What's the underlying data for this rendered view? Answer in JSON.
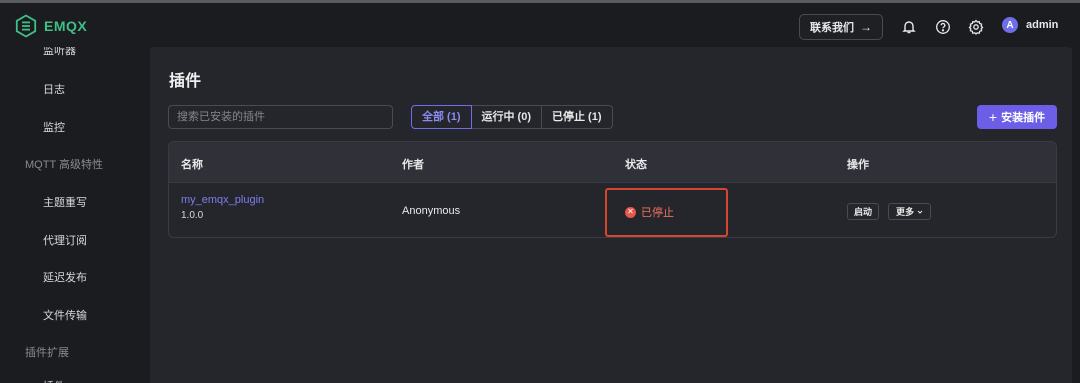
{
  "app": {
    "brand": "EMQX",
    "brand_color": "#3fbf86",
    "accent": "#6d5ee8"
  },
  "header": {
    "contact_label": "联系我们",
    "contact_arrow": "→",
    "icons": [
      "bell-icon",
      "help-icon",
      "settings-icon"
    ],
    "user": {
      "avatar_letter": "A",
      "name": "admin"
    }
  },
  "sidebar": {
    "cut_top_label": "监听器",
    "items": [
      {
        "label": "日志"
      },
      {
        "label": "监控"
      }
    ],
    "group_mqtt": "MQTT 高级特性",
    "mqtt_items": [
      {
        "label": "主题重写"
      },
      {
        "label": "代理订阅"
      },
      {
        "label": "延迟发布"
      },
      {
        "label": "文件传输"
      }
    ],
    "group_plugins": "插件扩展",
    "cut_bottom_label": "插件"
  },
  "main": {
    "title": "插件",
    "search_placeholder": "搜索已安装的插件",
    "tabs": [
      {
        "label": "全部 (1)",
        "active": true
      },
      {
        "label": "运行中 (0)",
        "active": false
      },
      {
        "label": "已停止 (1)",
        "active": false
      }
    ],
    "install_label": "安装插件",
    "install_plus": "+",
    "table": {
      "headers": [
        "名称",
        "作者",
        "状态",
        "操作"
      ],
      "rows": [
        {
          "name": "my_emqx_plugin",
          "version": "1.0.0",
          "author": "Anonymous",
          "status": "已停止",
          "status_color": "#e8574a",
          "actions": {
            "start": "启动",
            "more": "更多"
          }
        }
      ]
    }
  }
}
